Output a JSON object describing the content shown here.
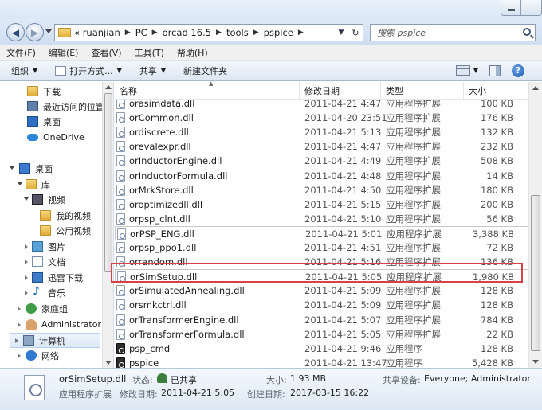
{
  "window": {
    "ghost_title": "..."
  },
  "nav": {
    "back_glyph": "◀",
    "forward_glyph": "▶",
    "breadcrumb": [
      "«  ruanjian",
      "PC",
      "orcad 16.5",
      "tools",
      "pspice"
    ],
    "search_placeholder": "搜索 pspice"
  },
  "menubar": [
    "文件(F)",
    "编辑(E)",
    "查看(V)",
    "工具(T)",
    "帮助(H)"
  ],
  "toolbar": {
    "organize": "组织",
    "open_with": "打开方式...",
    "share": "共享",
    "new_folder": "新建文件夹",
    "help": "?"
  },
  "navpane": {
    "items": [
      {
        "label": "下载",
        "icon": "download-folder-icon"
      },
      {
        "label": "最近访问的位置",
        "icon": "recent-places-icon"
      },
      {
        "label": "桌面",
        "icon": "desktop-icon"
      },
      {
        "label": "OneDrive",
        "icon": "onedrive-icon"
      },
      {
        "label": "桌面",
        "icon": "desktop-icon"
      },
      {
        "label": "库",
        "icon": "library-icon"
      },
      {
        "label": "视频",
        "icon": "video-icon"
      },
      {
        "label": "我的视频",
        "icon": "folder-icon"
      },
      {
        "label": "公用视频",
        "icon": "folder-icon"
      },
      {
        "label": "图片",
        "icon": "pictures-icon"
      },
      {
        "label": "文档",
        "icon": "documents-icon"
      },
      {
        "label": "迅雷下载",
        "icon": "xunlei-icon"
      },
      {
        "label": "音乐",
        "icon": "music-icon"
      },
      {
        "label": "家庭组",
        "icon": "homegroup-icon"
      },
      {
        "label": "Administrator",
        "icon": "user-icon"
      },
      {
        "label": "计算机",
        "icon": "computer-icon"
      },
      {
        "label": "网络",
        "icon": "network-icon"
      }
    ]
  },
  "columns": {
    "name": "名称",
    "date": "修改日期",
    "type": "类型",
    "size": "大小"
  },
  "files": [
    {
      "name": "orasimdata.dll",
      "date": "2011-04-21 4:47",
      "type": "应用程序扩展",
      "size": "100 KB"
    },
    {
      "name": "orCommon.dll",
      "date": "2011-04-20 23:51",
      "type": "应用程序扩展",
      "size": "176 KB"
    },
    {
      "name": "ordiscrete.dll",
      "date": "2011-04-21 5:13",
      "type": "应用程序扩展",
      "size": "132 KB"
    },
    {
      "name": "orevalexpr.dll",
      "date": "2011-04-21 4:47",
      "type": "应用程序扩展",
      "size": "232 KB"
    },
    {
      "name": "orInductorEngine.dll",
      "date": "2011-04-21 4:49",
      "type": "应用程序扩展",
      "size": "508 KB"
    },
    {
      "name": "orInductorFormula.dll",
      "date": "2011-04-21 4:48",
      "type": "应用程序扩展",
      "size": "14 KB"
    },
    {
      "name": "orMrkStore.dll",
      "date": "2011-04-21 4:50",
      "type": "应用程序扩展",
      "size": "180 KB"
    },
    {
      "name": "oroptimizedll.dll",
      "date": "2011-04-21 5:15",
      "type": "应用程序扩展",
      "size": "200 KB"
    },
    {
      "name": "orpsp_clnt.dll",
      "date": "2011-04-21 5:10",
      "type": "应用程序扩展",
      "size": "56 KB"
    },
    {
      "name": "orPSP_ENG.dll",
      "date": "2011-04-21 5:01",
      "type": "应用程序扩展",
      "size": "3,388 KB"
    },
    {
      "name": "orpsp_ppo1.dll",
      "date": "2011-04-21 4:51",
      "type": "应用程序扩展",
      "size": "72 KB"
    },
    {
      "name": "orrandom.dll",
      "date": "2011-04-21 5:16",
      "type": "应用程序扩展",
      "size": "136 KB"
    },
    {
      "name": "orSimSetup.dll",
      "date": "2011-04-21 5:05",
      "type": "应用程序扩展",
      "size": "1,980 KB"
    },
    {
      "name": "orSimulatedAnnealing.dll",
      "date": "2011-04-21 5:09",
      "type": "应用程序扩展",
      "size": "128 KB"
    },
    {
      "name": "orsmkctrl.dll",
      "date": "2011-04-21 5:09",
      "type": "应用程序扩展",
      "size": "128 KB"
    },
    {
      "name": "orTransformerEngine.dll",
      "date": "2011-04-21 5:07",
      "type": "应用程序扩展",
      "size": "784 KB"
    },
    {
      "name": "orTransformerFormula.dll",
      "date": "2011-04-21 5:05",
      "type": "应用程序扩展",
      "size": "22 KB"
    },
    {
      "name": "psp_cmd",
      "date": "2011-04-21 9:46",
      "type": "应用程序",
      "size": "128 KB"
    },
    {
      "name": "pspice",
      "date": "2011-04-21 13:47",
      "type": "应用程序",
      "size": "5,428 KB"
    }
  ],
  "details": {
    "filename": "orSimSetup.dll",
    "filetype": "应用程序扩展",
    "state_label": "状态:",
    "state_value": "已共享",
    "modified_label": "修改日期:",
    "modified_value": "2011-04-21 5:05",
    "size_label": "大小:",
    "size_value": "1.93 MB",
    "created_label": "创建日期:",
    "created_value": "2017-03-15 16:22",
    "share_label": "共享设备:",
    "share_value": "Everyone; Administrator"
  },
  "colors": {
    "highlight": "#d9404a"
  }
}
